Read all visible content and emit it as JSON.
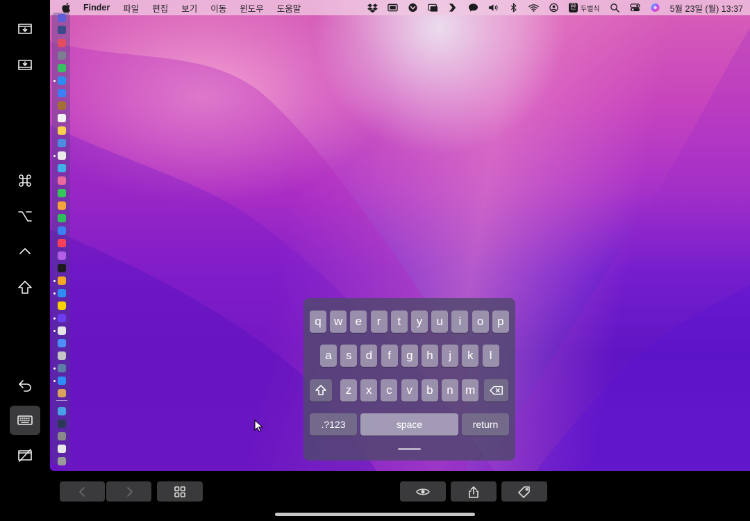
{
  "menubar": {
    "app_name": "Finder",
    "menus": [
      "파일",
      "편집",
      "보기",
      "이동",
      "윈도우",
      "도움말"
    ],
    "input_method": "한",
    "input_method_name": "두벌식",
    "clock": "5월 23일 (월)  13:37"
  },
  "keyboard": {
    "row1": [
      "q",
      "w",
      "e",
      "r",
      "t",
      "y",
      "u",
      "i",
      "o",
      "p"
    ],
    "row2": [
      "a",
      "s",
      "d",
      "f",
      "g",
      "h",
      "j",
      "k",
      "l"
    ],
    "row3": [
      "z",
      "x",
      "c",
      "v",
      "b",
      "n",
      "m"
    ],
    "numbers_key": ".?123",
    "space_key": "space",
    "return_key": "return"
  },
  "left_toolbar": {
    "icons": [
      "screen-download-icon",
      "screen-download-alt-icon",
      "command-key-icon",
      "option-key-icon",
      "control-key-icon",
      "shift-key-icon",
      "undo-icon",
      "keyboard-icon",
      "no-display-icon"
    ]
  },
  "bottom_toolbar": {
    "icons": [
      "back-icon",
      "forward-icon",
      "grid-icon",
      "eye-icon",
      "share-icon",
      "tag-icon"
    ]
  },
  "dock": {
    "icon_count": 35
  }
}
